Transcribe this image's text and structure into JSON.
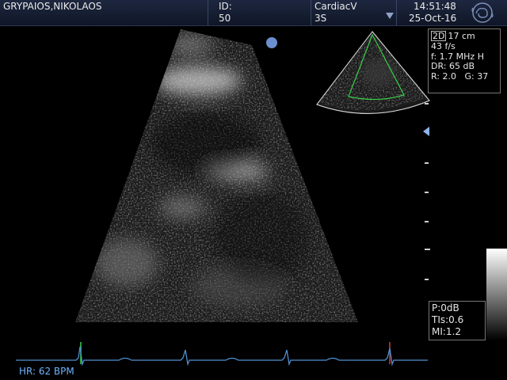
{
  "header": {
    "patient_name": "GRYPAIOS,NIKOLAOS",
    "id_label": "ID:",
    "id_value": "50",
    "application": "CardiacV",
    "probe": "3S",
    "time": "14:51:48",
    "date": "25-Oct-16",
    "logo_icon": "ge-logo-icon"
  },
  "params": {
    "mode": "2D",
    "depth": "17 cm",
    "frame_rate": "43 f/s",
    "frequency": "f: 1.7 MHz H",
    "dynamic_range": "DR: 65 dB",
    "r": "R: 2.0",
    "gain": "G: 37"
  },
  "indices": {
    "power": "P:0dB",
    "tis": "TIs:0.6",
    "mi": "MI:1.2"
  },
  "ecg": {
    "heart_rate": "HR: 62 BPM",
    "trace_color": "#4f8fd0"
  },
  "colors": {
    "header_bg": "#162038",
    "sector_outline": "#39d24a",
    "marker": "#6c8fd0"
  }
}
